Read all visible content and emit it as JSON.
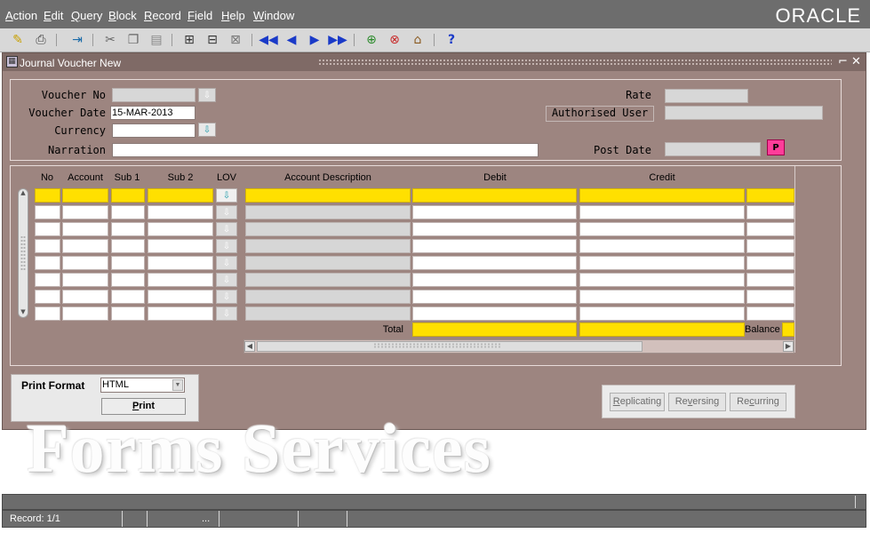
{
  "menu": [
    {
      "key": "A",
      "rest": "ction"
    },
    {
      "key": "E",
      "rest": "dit"
    },
    {
      "key": "Q",
      "rest": "uery"
    },
    {
      "key": "B",
      "rest": "lock"
    },
    {
      "key": "R",
      "rest": "ecord"
    },
    {
      "key": "F",
      "rest": "ield"
    },
    {
      "key": "H",
      "rest": "elp"
    },
    {
      "key": "W",
      "rest": "indow"
    }
  ],
  "brand": "ORACLE",
  "toolbar_icons": [
    "save-icon",
    "print-icon",
    "exit-icon",
    "cut-icon",
    "copy-icon",
    "paste-icon",
    "query-icon",
    "execute-query-icon",
    "cancel-query-icon",
    "first-record-icon",
    "previous-record-icon",
    "next-record-icon",
    "last-record-icon",
    "insert-record-icon",
    "delete-record-icon",
    "list-values-icon",
    "help-icon"
  ],
  "window": {
    "title": "Journal Voucher New",
    "minimize_glyph": "⌐",
    "close_glyph": "✕"
  },
  "header": {
    "voucher_no_label": "Voucher No",
    "voucher_no_value": "",
    "voucher_date_label": "Voucher Date",
    "voucher_date_value": "15-MAR-2013",
    "currency_label": "Currency",
    "currency_value": "",
    "narration_label": "Narration",
    "narration_value": "",
    "rate_label": "Rate",
    "rate_value": "",
    "authorised_user_label": "Authorised User",
    "authorised_user_value": "",
    "post_date_label": "Post Date",
    "post_date_value": "",
    "post_button_label": "P"
  },
  "lines": {
    "columns": {
      "no": "No",
      "account": "Account",
      "sub1": "Sub 1",
      "sub2": "Sub 2",
      "lov": "LOV",
      "account_description": "Account Description",
      "debit": "Debit",
      "credit": "Credit"
    },
    "row_count": 8,
    "total_label": "Total",
    "total_debit": "",
    "total_credit": "",
    "balance_label": "Balance",
    "balance_value": ""
  },
  "print": {
    "format_label": "Print Format",
    "format_value": "HTML",
    "print_button_key": "P",
    "print_button_rest": "rint"
  },
  "actions": {
    "replicating_key": "R",
    "replicating_rest": "eplicating",
    "reversing_pre": "Re",
    "reversing_key": "v",
    "reversing_rest": "ersing",
    "recurring_pre": "Re",
    "recurring_key": "c",
    "recurring_rest": "urring"
  },
  "watermark": "Forms Services",
  "status": {
    "record": "Record: 1/1",
    "ellipsis": "..."
  },
  "colors": {
    "window_bg": "#9d8580",
    "current_row": "#ffe000",
    "menubar": "#6d6d6d",
    "post_button": "#ff3d9a"
  }
}
